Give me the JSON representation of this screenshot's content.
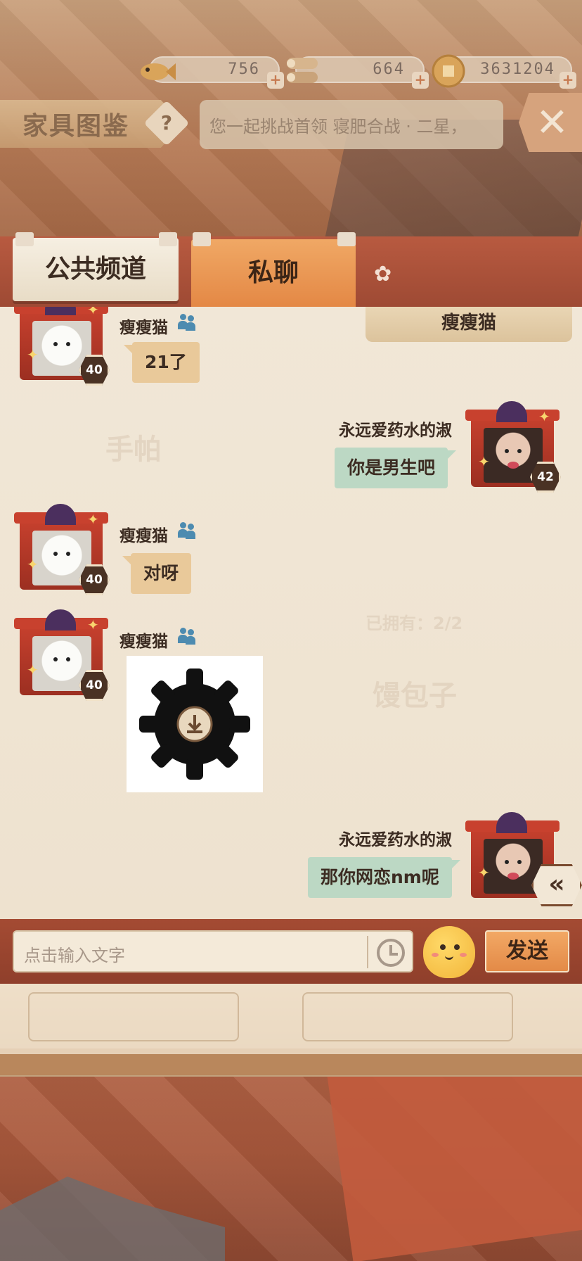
{
  "currencies": [
    {
      "name": "fish",
      "value": "756",
      "icon": "fish-icon"
    },
    {
      "name": "wood",
      "value": "664",
      "icon": "wood-log-icon"
    },
    {
      "name": "coin",
      "value": "3631204",
      "icon": "coin-icon"
    }
  ],
  "header": {
    "title": "家具图鉴",
    "help_symbol": "?",
    "ticker_text": "您一起挑战首领 寝肥合战 · 二星，",
    "close_symbol": "✕"
  },
  "tabs": {
    "public": "公共频道",
    "private": "私聊"
  },
  "chat": {
    "partner_name": "瘦瘦猫",
    "messages": [
      {
        "side": "left",
        "sender": "瘦瘦猫",
        "level": "40",
        "text": "21了"
      },
      {
        "side": "right",
        "sender": "永远爱药水的淑",
        "level": "42",
        "text": "你是男生吧"
      },
      {
        "side": "left",
        "sender": "瘦瘦猫",
        "level": "40",
        "text": "对呀"
      },
      {
        "side": "left",
        "sender": "瘦瘦猫",
        "level": "40",
        "text": ""
      },
      {
        "side": "right",
        "sender": "永远爱药水的淑",
        "level": "",
        "text": "那你网恋nm呢"
      }
    ],
    "collapse_symbol": "«"
  },
  "input": {
    "placeholder": "点击输入文字",
    "send_label": "发送"
  },
  "colors": {
    "accent_orange": "#e38643",
    "left_bubble": "#e9c99a",
    "right_bubble": "#bcd8c4",
    "panel_bg": "#f1e7d7"
  }
}
